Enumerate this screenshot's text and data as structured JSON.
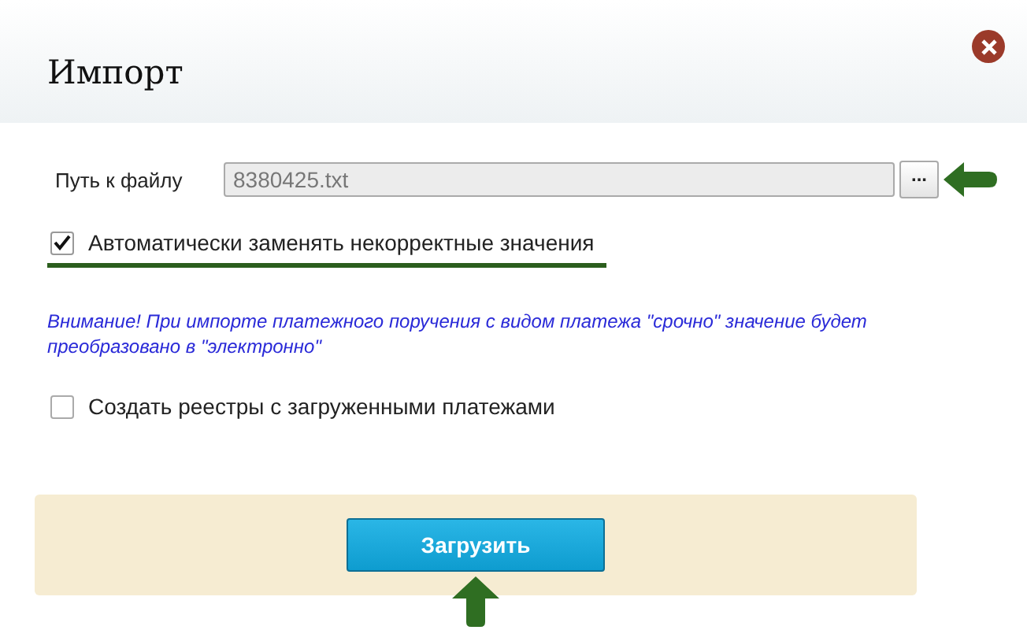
{
  "window": {
    "title": "Импорт"
  },
  "file_path": {
    "label": "Путь к файлу",
    "value": "8380425.txt",
    "browse_label": "..."
  },
  "options": [
    {
      "label": "Автоматически заменять некорректные значения",
      "checked": true,
      "highlighted": true
    },
    {
      "label": "Создать реестры с загруженными платежами",
      "checked": false,
      "highlighted": false
    }
  ],
  "notice": "Внимание! При импорте платежного поручения с видом платежа \"срочно\" значение будет преобразовано в \"электронно\"",
  "submit_label": "Загрузить"
}
